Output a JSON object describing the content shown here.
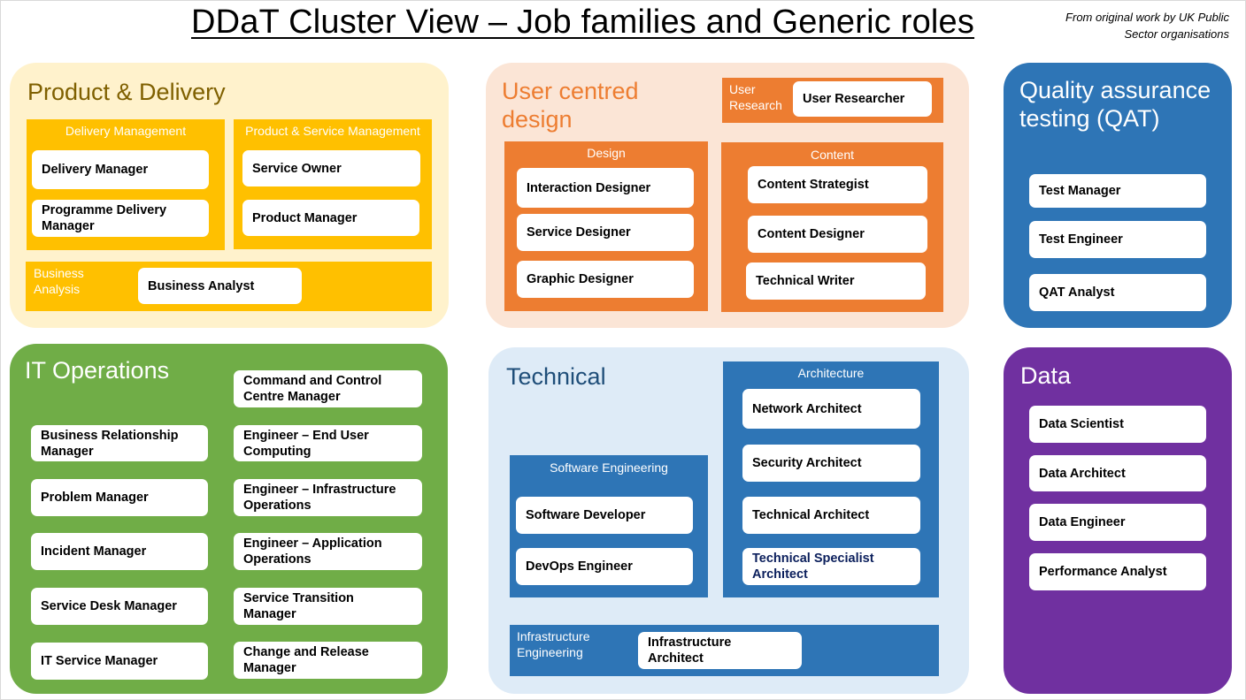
{
  "header": {
    "title": "DDaT Cluster View – Job families and Generic roles",
    "credit": "From original work by UK Public Sector organisations"
  },
  "colors": {
    "product_delivery_bg": "#fff2cc",
    "product_delivery_family": "#ffc000",
    "product_delivery_title": "#7f6000",
    "ucd_bg": "#fbe5d6",
    "ucd_family": "#ed7d31",
    "qat_bg": "#2e75b6",
    "it_operations_bg": "#70ad47",
    "technical_bg": "#deebf7",
    "technical_family": "#2e75b6",
    "technical_title": "#1f4e79",
    "data_bg": "#7030a0",
    "role_bg": "#ffffff",
    "highlight_role_text": "#0b1f5c"
  },
  "clusters": {
    "product_delivery": {
      "title": "Product & Delivery",
      "families": {
        "delivery_management": {
          "label": "Delivery Management",
          "roles": [
            "Delivery Manager",
            "Programme Delivery Manager"
          ]
        },
        "product_service_management": {
          "label": "Product & Service Management",
          "roles": [
            "Service Owner",
            "Product Manager"
          ]
        },
        "business_analysis": {
          "label": "Business Analysis",
          "roles": [
            "Business Analyst"
          ]
        }
      }
    },
    "ucd": {
      "title": "User centred design",
      "families": {
        "user_research": {
          "label": "User Research",
          "roles": [
            "User Researcher"
          ]
        },
        "design": {
          "label": "Design",
          "roles": [
            "Interaction Designer",
            "Service Designer",
            "Graphic Designer"
          ]
        },
        "content": {
          "label": "Content",
          "roles": [
            "Content Strategist",
            "Content Designer",
            "Technical Writer"
          ]
        }
      }
    },
    "qat": {
      "title": "Quality assurance testing (QAT)",
      "roles": [
        "Test Manager",
        "Test Engineer",
        "QAT Analyst"
      ]
    },
    "it_operations": {
      "title": "IT Operations",
      "left_roles": [
        "Business Relationship Manager",
        "Problem Manager",
        "Incident Manager",
        "Service Desk Manager",
        "IT Service Manager"
      ],
      "right_roles": [
        "Command and Control Centre Manager",
        "Engineer – End User Computing",
        "Engineer – Infrastructure Operations",
        "Engineer – Application Operations",
        "Service Transition Manager",
        "Change and Release Manager"
      ]
    },
    "technical": {
      "title": "Technical",
      "families": {
        "architecture": {
          "label": "Architecture",
          "roles": [
            "Network Architect",
            "Security Architect",
            "Technical Architect",
            "Technical Specialist Architect"
          ]
        },
        "software_engineering": {
          "label": "Software Engineering",
          "roles": [
            "Software Developer",
            "DevOps Engineer"
          ]
        },
        "infrastructure_engineering": {
          "label": "Infrastructure Engineering",
          "roles": [
            "Infrastructure Architect"
          ]
        }
      }
    },
    "data": {
      "title": "Data",
      "roles": [
        "Data Scientist",
        "Data Architect",
        "Data Engineer",
        "Performance Analyst"
      ]
    }
  }
}
